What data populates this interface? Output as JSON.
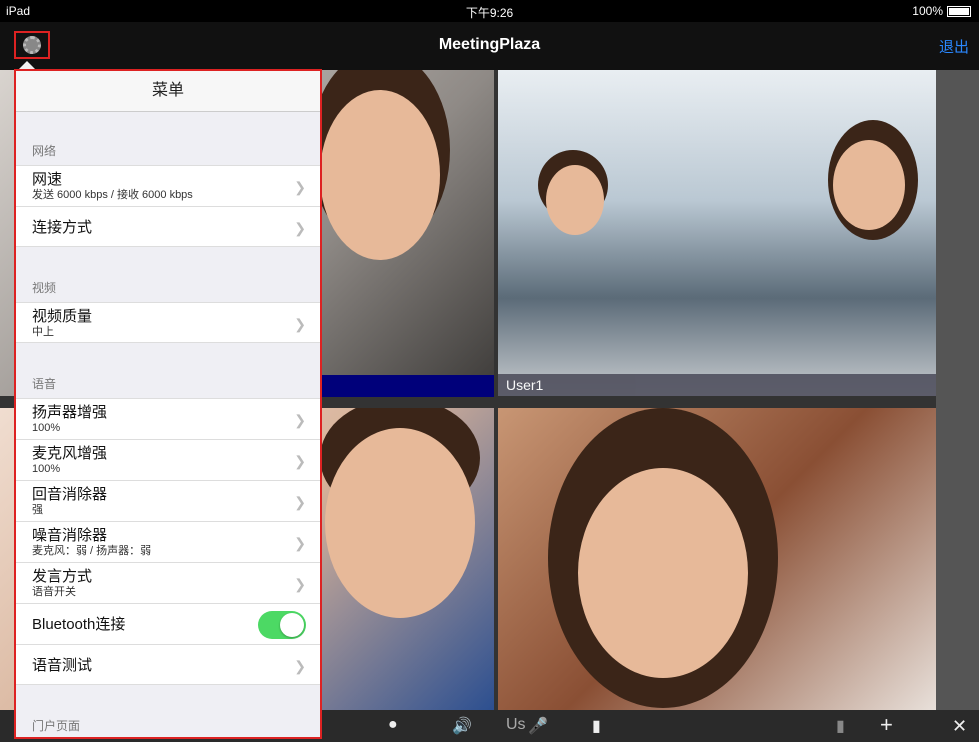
{
  "status": {
    "device": "iPad",
    "time": "下午9:26",
    "battery": "100%"
  },
  "nav": {
    "title": "MeetingPlaza",
    "logout": "退出"
  },
  "tiles": {
    "user1_name": "User1",
    "user2_partial": "Us"
  },
  "menu": {
    "title": "菜单",
    "sections": [
      {
        "title": "网络",
        "rows": [
          {
            "label": "网速",
            "sub": "发送 6000 kbps / 接收 6000 kbps"
          },
          {
            "label": "连接方式"
          }
        ]
      },
      {
        "title": "视频",
        "rows": [
          {
            "label": "视频质量",
            "sub": "中上"
          }
        ]
      },
      {
        "title": "语音",
        "rows": [
          {
            "label": "扬声器增强",
            "sub": "100%"
          },
          {
            "label": "麦克风增强",
            "sub": "100%"
          },
          {
            "label": "回音消除器",
            "sub": "强"
          },
          {
            "label": "噪音消除器",
            "sub": "麦克风：弱 / 扬声器：弱"
          },
          {
            "label": "发言方式",
            "sub": "语音开关"
          },
          {
            "label": "Bluetooth连接",
            "toggle": true
          },
          {
            "label": "语音测试"
          }
        ]
      },
      {
        "title": "门户页面"
      }
    ]
  },
  "toolbar": {
    "plus": "+",
    "close": "✕"
  }
}
